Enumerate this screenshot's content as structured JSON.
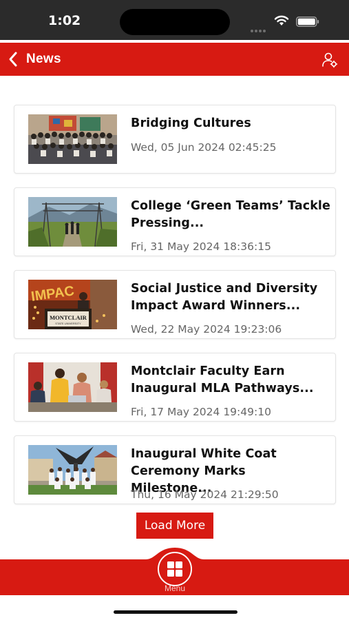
{
  "status_bar": {
    "time": "1:02"
  },
  "header": {
    "title": "News",
    "back_icon": "chevron-left-icon",
    "profile_icon": "user-settings-icon"
  },
  "news": [
    {
      "title": "Bridging Cultures",
      "date": "Wed, 05 Jun 2024 02:45:25"
    },
    {
      "title": "College ‘Green Teams’ Tackle Pressing...",
      "date": "Fri, 31 May 2024 18:36:15"
    },
    {
      "title": "Social Justice and Diversity Impact Award Winners...",
      "date": "Wed, 22 May 2024 19:23:06"
    },
    {
      "title": "Montclair Faculty Earn Inaugural MLA Pathways...",
      "date": "Fri, 17 May 2024 19:49:10"
    },
    {
      "title": "Inaugural White Coat Ceremony Marks Milestone...",
      "date": "Thu, 16 May 2024 21:29:50"
    }
  ],
  "thumb_text": {
    "podium_sign": "MONTCLAIR",
    "podium_sub": "STATE UNIVERSITY",
    "banner": "IMPAC"
  },
  "load_more": "Load More",
  "bottom_nav": {
    "menu_label": "Menu",
    "menu_icon": "grid-icon"
  },
  "colors": {
    "brand_red": "#d71a12",
    "status_bar": "#2b2b2b"
  }
}
